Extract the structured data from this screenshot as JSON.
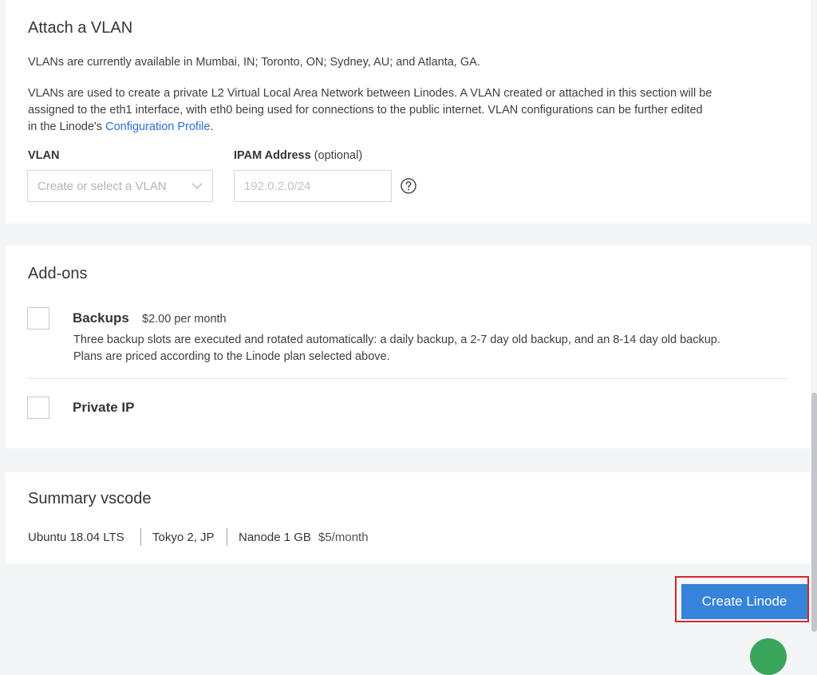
{
  "vlan": {
    "title": "Attach a VLAN",
    "availability": "VLANs are currently available in Mumbai, IN; Toronto, ON; Sydney, AU; and Atlanta, GA.",
    "description_line1": "VLANs are used to create a private L2 Virtual Local Area Network between Linodes. A VLAN created or attached in this section will be",
    "description_line2": "assigned to the eth1 interface, with eth0 being used for connections to the public internet. VLAN configurations can be further edited",
    "description_line3_prefix": "in the Linode's ",
    "config_link": "Configuration Profile",
    "description_line3_suffix": ".",
    "vlan_label": "VLAN",
    "vlan_placeholder": "Create or select a VLAN",
    "ipam_label": "IPAM Address",
    "ipam_optional": " (optional)",
    "ipam_placeholder": "192.0.2.0/24"
  },
  "addons": {
    "title": "Add-ons",
    "backups_label": "Backups",
    "backups_price": "$2.00 per month",
    "backups_desc_line1": "Three backup slots are executed and rotated automatically: a daily backup, a 2-7 day old backup, and an 8-14 day old backup.",
    "backups_desc_line2": "Plans are priced according to the Linode plan selected above.",
    "backups_checked": false,
    "private_ip_label": "Private IP",
    "private_ip_checked": false
  },
  "summary": {
    "title": "Summary vscode",
    "image": "Ubuntu 18.04 LTS",
    "region": "Tokyo 2, JP",
    "plan": "Nanode 1 GB",
    "price": "$5/month"
  },
  "actions": {
    "create_label": "Create Linode"
  },
  "colors": {
    "primary": "#3683dc",
    "link": "#2b6ed2",
    "highlight": "#d8252b"
  },
  "icons": {
    "help": "help-circle-icon",
    "dropdown": "chevron-down-icon"
  }
}
